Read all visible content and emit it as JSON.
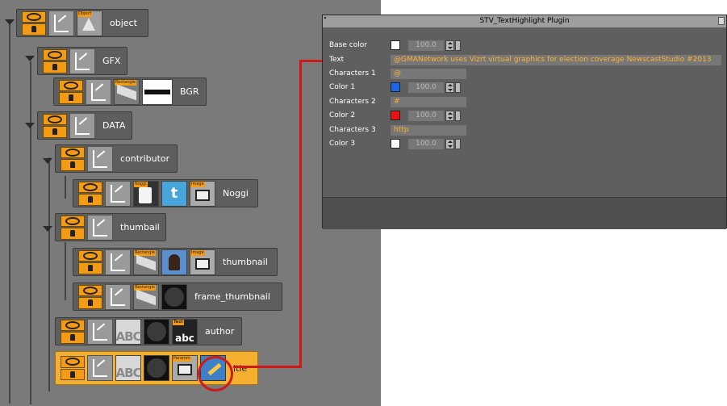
{
  "tree": {
    "nodes": [
      {
        "label": "object",
        "thumbs": [
          {
            "kind": "cone",
            "tag": "Object"
          }
        ]
      },
      {
        "label": "GFX",
        "thumbs": []
      },
      {
        "label": "BGR",
        "thumbs": [
          {
            "kind": "rectangle",
            "tag": "Rectangle"
          },
          {
            "kind": "bgr",
            "tag": ""
          }
        ]
      },
      {
        "label": "DATA",
        "thumbs": []
      },
      {
        "label": "contributor",
        "thumbs": []
      },
      {
        "label": "Noggi",
        "thumbs": [
          {
            "kind": "noggi",
            "tag": "Noggi"
          },
          {
            "kind": "twitter",
            "tag": ""
          },
          {
            "kind": "image",
            "tag": "Image"
          }
        ]
      },
      {
        "label": "thumbail",
        "thumbs": []
      },
      {
        "label": "thumbnail",
        "thumbs": [
          {
            "kind": "rectangle",
            "tag": "Rectangle"
          },
          {
            "kind": "photo",
            "tag": ""
          },
          {
            "kind": "image",
            "tag": "Image"
          }
        ]
      },
      {
        "label": "frame_thumbnail",
        "thumbs": [
          {
            "kind": "rectangle",
            "tag": "Rectangle"
          },
          {
            "kind": "sphere",
            "tag": ""
          }
        ]
      },
      {
        "label": "author",
        "thumbs": [
          {
            "kind": "abc",
            "tag": "Text"
          },
          {
            "kind": "sphere",
            "tag": ""
          },
          {
            "kind": "text",
            "tag": "Text"
          }
        ]
      },
      {
        "label": "itle",
        "thumbs": [
          {
            "kind": "abc",
            "tag": "Text"
          },
          {
            "kind": "sphere",
            "tag": ""
          },
          {
            "kind": "param",
            "tag": "Paramm"
          },
          {
            "kind": "plugin",
            "tag": ""
          }
        ]
      }
    ],
    "twitter_glyph": "t",
    "abc_glyph": "ABC",
    "text_glyph": "abc"
  },
  "plugin_panel": {
    "title": "STV_TextHighlight Plugin",
    "rows": {
      "base_color": {
        "label": "Base color",
        "color": "#ffffff",
        "value": "100.0"
      },
      "text": {
        "label": "Text",
        "value": "@GMANetwork uses Vizrt virtual graphics for election coverage NewscastStudio #2013"
      },
      "chars1": {
        "label": "Characters 1",
        "value": "@"
      },
      "color1": {
        "label": "Color 1",
        "color": "#1a66ee",
        "value": "100.0"
      },
      "chars2": {
        "label": "Characters 2",
        "value": "#"
      },
      "color2": {
        "label": "Color 2",
        "color": "#ee1111",
        "value": "100.0"
      },
      "chars3": {
        "label": "Characters 3",
        "value": "http"
      },
      "color3": {
        "label": "Color 3",
        "color": "#ffffff",
        "value": "100.0"
      }
    }
  },
  "colors": {
    "tree_bg": "#7a7a7a",
    "selected_node": "#f5b030",
    "highlight_red": "#d01818",
    "control_orange": "#f39b15",
    "text_accent": "#ffb032"
  }
}
